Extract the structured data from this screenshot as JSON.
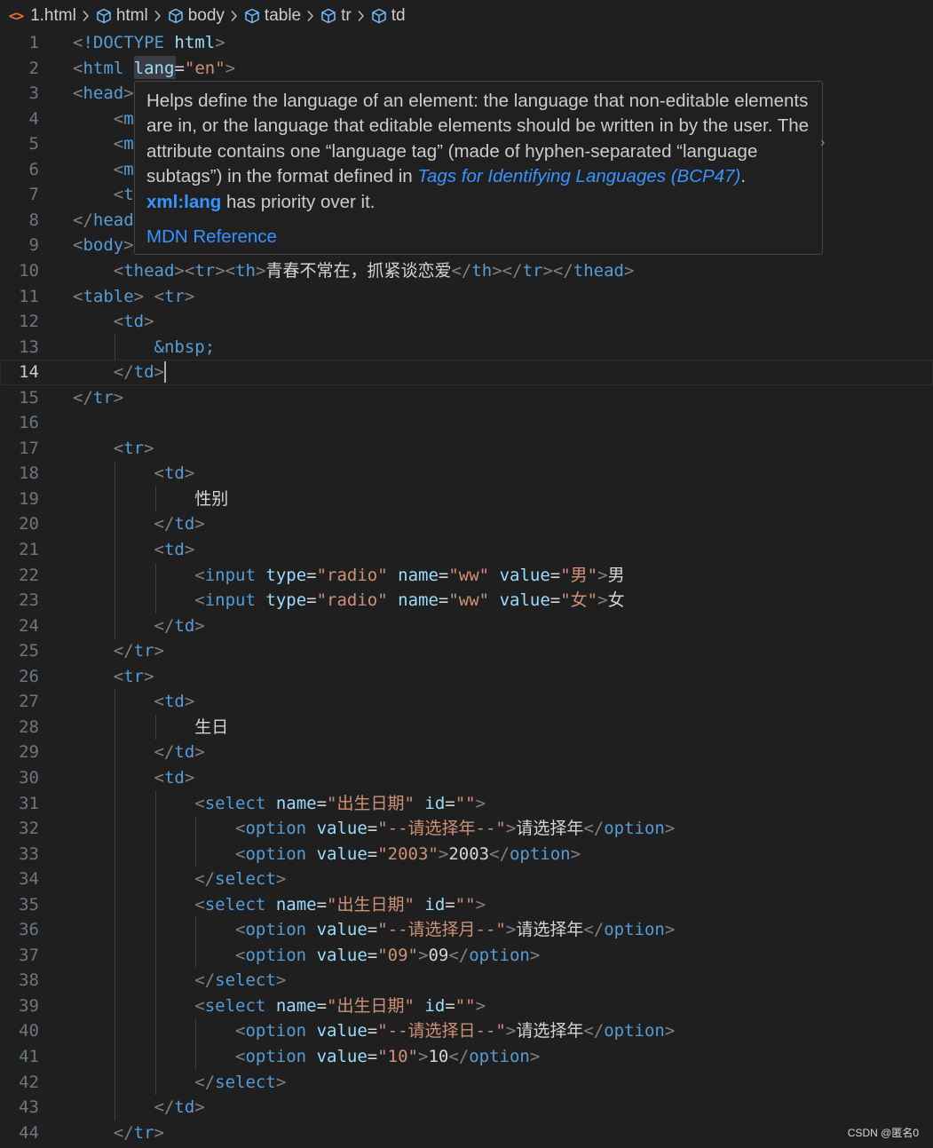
{
  "breadcrumb": {
    "file": "1.html",
    "items": [
      "html",
      "body",
      "table",
      "tr",
      "td"
    ]
  },
  "colors": {
    "background": "#1f1f1f",
    "tag": "#569cd6",
    "attribute": "#9cdcfe",
    "string": "#ce9178",
    "punctuation": "#808080",
    "link": "#3794ff"
  },
  "hover": {
    "text_before_link": "Helps define the language of an element: the language that non-editable elements are in, or the language that editable elements should be written in by the user. The attribute contains one “language tag” (made of hyphen-separated “language subtags”) in the format defined in ",
    "link_text": "Tags for Identifying Languages (BCP47)",
    "text_after_link": ". ",
    "code_text": "xml:lang",
    "text_end": " has priority over it.",
    "mdn_label": "MDN Reference"
  },
  "lines": [
    {
      "n": "1",
      "tokens": [
        [
          "p",
          "<"
        ],
        [
          "t",
          "!DOCTYPE"
        ],
        [
          "w",
          " "
        ],
        [
          "a",
          "html"
        ],
        [
          "p",
          ">"
        ]
      ]
    },
    {
      "n": "2",
      "tokens": [
        [
          "p",
          "<"
        ],
        [
          "t",
          "html"
        ],
        [
          "w",
          " "
        ],
        [
          "a",
          "lang"
        ],
        [
          "w",
          "="
        ],
        [
          "s",
          "\"en\""
        ],
        [
          "p",
          ">"
        ]
      ]
    },
    {
      "n": "3",
      "tokens": [
        [
          "p",
          "<"
        ],
        [
          "t",
          "head"
        ],
        [
          "p",
          ">"
        ]
      ]
    },
    {
      "n": "4",
      "tokens": [
        [
          "w",
          "    "
        ],
        [
          "p",
          "<"
        ],
        [
          "t",
          "m"
        ]
      ]
    },
    {
      "n": "5",
      "tokens": [
        [
          "w",
          "    "
        ],
        [
          "p",
          "<"
        ],
        [
          "t",
          "m"
        ]
      ]
    },
    {
      "n": "6",
      "tokens": [
        [
          "w",
          "    "
        ],
        [
          "p",
          "<"
        ],
        [
          "t",
          "m"
        ]
      ]
    },
    {
      "n": "7",
      "tokens": [
        [
          "w",
          "    "
        ],
        [
          "p",
          "<"
        ],
        [
          "t",
          "t"
        ]
      ]
    },
    {
      "n": "8",
      "tokens": [
        [
          "p",
          "</"
        ],
        [
          "t",
          "head"
        ]
      ]
    },
    {
      "n": "9",
      "tokens": [
        [
          "p",
          "<"
        ],
        [
          "t",
          "body"
        ],
        [
          "p",
          ">"
        ]
      ]
    },
    {
      "n": "10",
      "tokens": [
        [
          "w",
          "    "
        ],
        [
          "p",
          "<"
        ],
        [
          "t",
          "thead"
        ],
        [
          "p",
          "><"
        ],
        [
          "t",
          "tr"
        ],
        [
          "p",
          "><"
        ],
        [
          "t",
          "th"
        ],
        [
          "p",
          ">"
        ],
        [
          "e",
          "青春不常在，抓紧谈恋爱"
        ],
        [
          "p",
          "</"
        ],
        [
          "t",
          "th"
        ],
        [
          "p",
          "></"
        ],
        [
          "t",
          "tr"
        ],
        [
          "p",
          "></"
        ],
        [
          "t",
          "thead"
        ],
        [
          "p",
          ">"
        ]
      ]
    },
    {
      "n": "11",
      "tokens": [
        [
          "p",
          "<"
        ],
        [
          "t",
          "table"
        ],
        [
          "p",
          ">"
        ],
        [
          "w",
          " "
        ],
        [
          "p",
          "<"
        ],
        [
          "t",
          "tr"
        ],
        [
          "p",
          ">"
        ]
      ]
    },
    {
      "n": "12",
      "tokens": [
        [
          "w",
          "    "
        ],
        [
          "p",
          "<"
        ],
        [
          "t",
          "td"
        ],
        [
          "p",
          ">"
        ]
      ]
    },
    {
      "n": "13",
      "tokens": [
        [
          "w",
          "        "
        ],
        [
          "ent",
          "&nbsp;"
        ]
      ]
    },
    {
      "n": "14",
      "tokens": [
        [
          "w",
          "    "
        ],
        [
          "p",
          "</"
        ],
        [
          "t",
          "td"
        ],
        [
          "p",
          ">"
        ]
      ]
    },
    {
      "n": "15",
      "tokens": [
        [
          "p",
          "</"
        ],
        [
          "t",
          "tr"
        ],
        [
          "p",
          ">"
        ]
      ]
    },
    {
      "n": "16",
      "tokens": []
    },
    {
      "n": "17",
      "tokens": [
        [
          "w",
          "    "
        ],
        [
          "p",
          "<"
        ],
        [
          "t",
          "tr"
        ],
        [
          "p",
          ">"
        ]
      ]
    },
    {
      "n": "18",
      "tokens": [
        [
          "w",
          "        "
        ],
        [
          "p",
          "<"
        ],
        [
          "t",
          "td"
        ],
        [
          "p",
          ">"
        ]
      ]
    },
    {
      "n": "19",
      "tokens": [
        [
          "w",
          "            "
        ],
        [
          "e",
          "性别"
        ]
      ]
    },
    {
      "n": "20",
      "tokens": [
        [
          "w",
          "        "
        ],
        [
          "p",
          "</"
        ],
        [
          "t",
          "td"
        ],
        [
          "p",
          ">"
        ]
      ]
    },
    {
      "n": "21",
      "tokens": [
        [
          "w",
          "        "
        ],
        [
          "p",
          "<"
        ],
        [
          "t",
          "td"
        ],
        [
          "p",
          ">"
        ]
      ]
    },
    {
      "n": "22",
      "tokens": [
        [
          "w",
          "            "
        ],
        [
          "p",
          "<"
        ],
        [
          "t",
          "input"
        ],
        [
          "w",
          " "
        ],
        [
          "a",
          "type"
        ],
        [
          "w",
          "="
        ],
        [
          "s",
          "\"radio\""
        ],
        [
          "w",
          " "
        ],
        [
          "a",
          "name"
        ],
        [
          "w",
          "="
        ],
        [
          "s",
          "\"ww\""
        ],
        [
          "w",
          " "
        ],
        [
          "a",
          "value"
        ],
        [
          "w",
          "="
        ],
        [
          "s",
          "\"男\""
        ],
        [
          "p",
          ">"
        ],
        [
          "e",
          "男"
        ]
      ]
    },
    {
      "n": "23",
      "tokens": [
        [
          "w",
          "            "
        ],
        [
          "p",
          "<"
        ],
        [
          "t",
          "input"
        ],
        [
          "w",
          " "
        ],
        [
          "a",
          "type"
        ],
        [
          "w",
          "="
        ],
        [
          "s",
          "\"radio\""
        ],
        [
          "w",
          " "
        ],
        [
          "a",
          "name"
        ],
        [
          "w",
          "="
        ],
        [
          "s",
          "\"ww\""
        ],
        [
          "w",
          " "
        ],
        [
          "a",
          "value"
        ],
        [
          "w",
          "="
        ],
        [
          "s",
          "\"女\""
        ],
        [
          "p",
          ">"
        ],
        [
          "e",
          "女"
        ]
      ]
    },
    {
      "n": "24",
      "tokens": [
        [
          "w",
          "        "
        ],
        [
          "p",
          "</"
        ],
        [
          "t",
          "td"
        ],
        [
          "p",
          ">"
        ]
      ]
    },
    {
      "n": "25",
      "tokens": [
        [
          "w",
          "    "
        ],
        [
          "p",
          "</"
        ],
        [
          "t",
          "tr"
        ],
        [
          "p",
          ">"
        ]
      ]
    },
    {
      "n": "26",
      "tokens": [
        [
          "w",
          "    "
        ],
        [
          "p",
          "<"
        ],
        [
          "t",
          "tr"
        ],
        [
          "p",
          ">"
        ]
      ]
    },
    {
      "n": "27",
      "tokens": [
        [
          "w",
          "        "
        ],
        [
          "p",
          "<"
        ],
        [
          "t",
          "td"
        ],
        [
          "p",
          ">"
        ]
      ]
    },
    {
      "n": "28",
      "tokens": [
        [
          "w",
          "            "
        ],
        [
          "e",
          "生日"
        ]
      ]
    },
    {
      "n": "29",
      "tokens": [
        [
          "w",
          "        "
        ],
        [
          "p",
          "</"
        ],
        [
          "t",
          "td"
        ],
        [
          "p",
          ">"
        ]
      ]
    },
    {
      "n": "30",
      "tokens": [
        [
          "w",
          "        "
        ],
        [
          "p",
          "<"
        ],
        [
          "t",
          "td"
        ],
        [
          "p",
          ">"
        ]
      ]
    },
    {
      "n": "31",
      "tokens": [
        [
          "w",
          "            "
        ],
        [
          "p",
          "<"
        ],
        [
          "t",
          "select"
        ],
        [
          "w",
          " "
        ],
        [
          "a",
          "name"
        ],
        [
          "w",
          "="
        ],
        [
          "s",
          "\"出生日期\""
        ],
        [
          "w",
          " "
        ],
        [
          "a",
          "id"
        ],
        [
          "w",
          "="
        ],
        [
          "s",
          "\"\""
        ],
        [
          "p",
          ">"
        ]
      ]
    },
    {
      "n": "32",
      "tokens": [
        [
          "w",
          "                "
        ],
        [
          "p",
          "<"
        ],
        [
          "t",
          "option"
        ],
        [
          "w",
          " "
        ],
        [
          "a",
          "value"
        ],
        [
          "w",
          "="
        ],
        [
          "s",
          "\"--请选择年--\""
        ],
        [
          "p",
          ">"
        ],
        [
          "e",
          "请选择年"
        ],
        [
          "p",
          "</"
        ],
        [
          "t",
          "option"
        ],
        [
          "p",
          ">"
        ]
      ]
    },
    {
      "n": "33",
      "tokens": [
        [
          "w",
          "                "
        ],
        [
          "p",
          "<"
        ],
        [
          "t",
          "option"
        ],
        [
          "w",
          " "
        ],
        [
          "a",
          "value"
        ],
        [
          "w",
          "="
        ],
        [
          "s",
          "\"2003\""
        ],
        [
          "p",
          ">"
        ],
        [
          "e",
          "2003"
        ],
        [
          "p",
          "</"
        ],
        [
          "t",
          "option"
        ],
        [
          "p",
          ">"
        ]
      ]
    },
    {
      "n": "34",
      "tokens": [
        [
          "w",
          "            "
        ],
        [
          "p",
          "</"
        ],
        [
          "t",
          "select"
        ],
        [
          "p",
          ">"
        ]
      ]
    },
    {
      "n": "35",
      "tokens": [
        [
          "w",
          "            "
        ],
        [
          "p",
          "<"
        ],
        [
          "t",
          "select"
        ],
        [
          "w",
          " "
        ],
        [
          "a",
          "name"
        ],
        [
          "w",
          "="
        ],
        [
          "s",
          "\"出生日期\""
        ],
        [
          "w",
          " "
        ],
        [
          "a",
          "id"
        ],
        [
          "w",
          "="
        ],
        [
          "s",
          "\"\""
        ],
        [
          "p",
          ">"
        ]
      ]
    },
    {
      "n": "36",
      "tokens": [
        [
          "w",
          "                "
        ],
        [
          "p",
          "<"
        ],
        [
          "t",
          "option"
        ],
        [
          "w",
          " "
        ],
        [
          "a",
          "value"
        ],
        [
          "w",
          "="
        ],
        [
          "s",
          "\"--请选择月--\""
        ],
        [
          "p",
          ">"
        ],
        [
          "e",
          "请选择年"
        ],
        [
          "p",
          "</"
        ],
        [
          "t",
          "option"
        ],
        [
          "p",
          ">"
        ]
      ]
    },
    {
      "n": "37",
      "tokens": [
        [
          "w",
          "                "
        ],
        [
          "p",
          "<"
        ],
        [
          "t",
          "option"
        ],
        [
          "w",
          " "
        ],
        [
          "a",
          "value"
        ],
        [
          "w",
          "="
        ],
        [
          "s",
          "\"09\""
        ],
        [
          "p",
          ">"
        ],
        [
          "e",
          "09"
        ],
        [
          "p",
          "</"
        ],
        [
          "t",
          "option"
        ],
        [
          "p",
          ">"
        ]
      ]
    },
    {
      "n": "38",
      "tokens": [
        [
          "w",
          "            "
        ],
        [
          "p",
          "</"
        ],
        [
          "t",
          "select"
        ],
        [
          "p",
          ">"
        ]
      ]
    },
    {
      "n": "39",
      "tokens": [
        [
          "w",
          "            "
        ],
        [
          "p",
          "<"
        ],
        [
          "t",
          "select"
        ],
        [
          "w",
          " "
        ],
        [
          "a",
          "name"
        ],
        [
          "w",
          "="
        ],
        [
          "s",
          "\"出生日期\""
        ],
        [
          "w",
          " "
        ],
        [
          "a",
          "id"
        ],
        [
          "w",
          "="
        ],
        [
          "s",
          "\"\""
        ],
        [
          "p",
          ">"
        ]
      ]
    },
    {
      "n": "40",
      "tokens": [
        [
          "w",
          "                "
        ],
        [
          "p",
          "<"
        ],
        [
          "t",
          "option"
        ],
        [
          "w",
          " "
        ],
        [
          "a",
          "value"
        ],
        [
          "w",
          "="
        ],
        [
          "s",
          "\"--请选择日--\""
        ],
        [
          "p",
          ">"
        ],
        [
          "e",
          "请选择年"
        ],
        [
          "p",
          "</"
        ],
        [
          "t",
          "option"
        ],
        [
          "p",
          ">"
        ]
      ]
    },
    {
      "n": "41",
      "tokens": [
        [
          "w",
          "                "
        ],
        [
          "p",
          "<"
        ],
        [
          "t",
          "option"
        ],
        [
          "w",
          " "
        ],
        [
          "a",
          "value"
        ],
        [
          "w",
          "="
        ],
        [
          "s",
          "\"10\""
        ],
        [
          "p",
          ">"
        ],
        [
          "e",
          "10"
        ],
        [
          "p",
          "</"
        ],
        [
          "t",
          "option"
        ],
        [
          "p",
          ">"
        ]
      ]
    },
    {
      "n": "42",
      "tokens": [
        [
          "w",
          "            "
        ],
        [
          "p",
          "</"
        ],
        [
          "t",
          "select"
        ],
        [
          "p",
          ">"
        ]
      ]
    },
    {
      "n": "43",
      "tokens": [
        [
          "w",
          "        "
        ],
        [
          "p",
          "</"
        ],
        [
          "t",
          "td"
        ],
        [
          "p",
          ">"
        ]
      ]
    },
    {
      "n": "44",
      "tokens": [
        [
          "w",
          "    "
        ],
        [
          "p",
          "</"
        ],
        [
          "t",
          "tr"
        ],
        [
          "p",
          ">"
        ]
      ]
    }
  ],
  "current_line": "14",
  "watermark": "CSDN @匿名0"
}
